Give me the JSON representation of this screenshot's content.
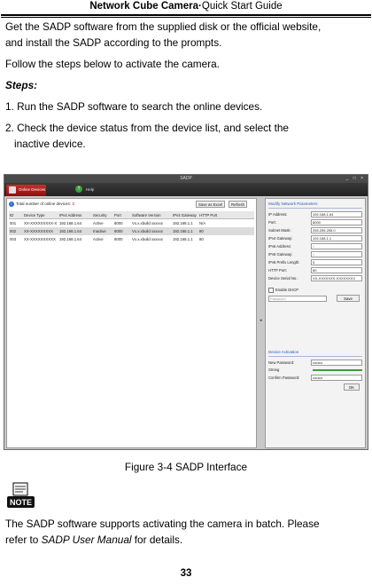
{
  "header": {
    "product": "Network Cube Camera",
    "separator": "·",
    "guide": "Quick Start Guide"
  },
  "intro_lines": [
    "Get the SADP software from the supplied disk or the official website,",
    "and install the SADP according to the prompts.",
    "Follow the steps below to activate the camera."
  ],
  "steps_label": "Steps:",
  "steps": [
    "1. Run the SADP software to search the online devices.",
    "2. Check the device status from the device list, and select the",
    "inactive device."
  ],
  "sadp": {
    "window_title": "SADP",
    "window_buttons": "_ □ ×",
    "tabs": {
      "online": "Online Devices",
      "help": "Help"
    },
    "status_prefix": "Total number of online devices:",
    "status_count": "3",
    "save_excel": "Save as Excel",
    "refresh": "Refresh",
    "columns": [
      "ID",
      "Device Type",
      "IPv4 Address",
      "Security",
      "Port",
      "Software Version",
      "IPv4 Gateway",
      "HTTP Port"
    ],
    "rows": [
      [
        "001",
        "XX-XXXXXXXXX-X",
        "192.168.1.64",
        "Active",
        "8000",
        "Vx.x.xbuild xxxxxx",
        "192.168.1.1",
        "N/A"
      ],
      [
        "002",
        "XX-XXXXXXXXX",
        "192.168.1.64",
        "Inactive",
        "8000",
        "Vx.x.xbuild xxxxxx",
        "192.168.1.1",
        "80"
      ],
      [
        "003",
        "XX-XXXXXXXXXX",
        "192.168.1.64",
        "Active",
        "8000",
        "Vx.x.xbuild xxxxxx",
        "192.168.1.1",
        "80"
      ]
    ],
    "modify_title": "Modify Network Parameters",
    "fields": [
      {
        "label": "IP Address:",
        "value": "192.168.1.64"
      },
      {
        "label": "Port:",
        "value": "8000"
      },
      {
        "label": "Subnet Mask:",
        "value": "255.255.255.0"
      },
      {
        "label": "IPv4 Gateway:",
        "value": "192.168.1.1"
      },
      {
        "label": "IPv6 Address:",
        "value": "::"
      },
      {
        "label": "IPv6 Gateway:",
        "value": "::"
      },
      {
        "label": "IPv6 Prefix Length:",
        "value": "0"
      },
      {
        "label": "HTTP Port:",
        "value": "80"
      },
      {
        "label": "Device Serial No.:",
        "value": "XX-XXXXXXX-XXXXXXXX"
      }
    ],
    "enable_dhcp": "Enable DHCP",
    "password_placeholder": "Password",
    "save": "Save",
    "activation_title": "Device Activation",
    "new_password_label": "New Password:",
    "new_password_value": "••••••••",
    "strong_label": "Strong",
    "strength": 1.0,
    "confirm_password_label": "Confirm Password:",
    "confirm_password_value": "••••••••",
    "ok": "OK"
  },
  "caption": "Figure 3-4 SADP Interface",
  "note_icon_text": "NOTE",
  "note_line1": "The SADP software supports activating the camera in batch. Please",
  "note_line2_prefix": "refer to ",
  "note_line2_italic": "SADP User Manual",
  "note_line2_suffix": " for details.",
  "page_number": "33"
}
